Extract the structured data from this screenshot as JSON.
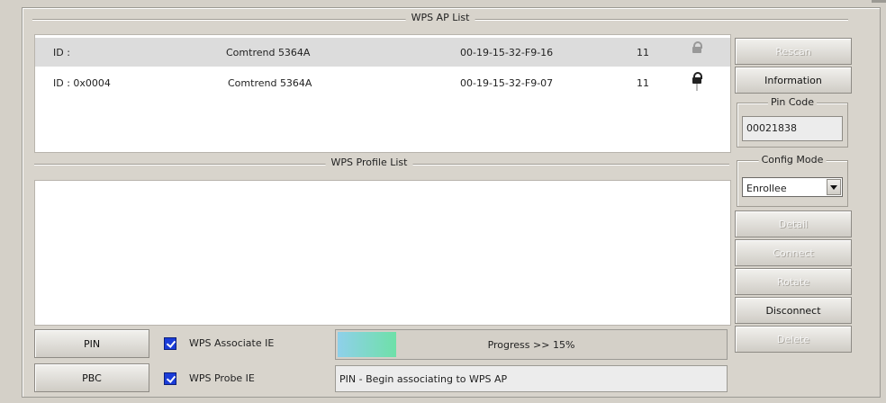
{
  "ap_list_title": "WPS AP List",
  "profile_list_title": "WPS Profile List",
  "ap_rows": [
    {
      "id": "ID :",
      "ssid": "Comtrend 5364A",
      "bssid": "00-19-15-32-F9-16",
      "channel": "11",
      "lock_icon": "lock-icon",
      "selected": true
    },
    {
      "id": "ID : 0x0004",
      "ssid": "Comtrend 5364A",
      "bssid": "00-19-15-32-F9-07",
      "channel": "11",
      "lock_icon": "lock-icon",
      "selected": false
    }
  ],
  "buttons": {
    "rescan": "Rescan",
    "information": "Information",
    "detail": "Detail",
    "connect": "Connect",
    "rotate": "Rotate",
    "disconnect": "Disconnect",
    "delete": "Delete",
    "pin": "PIN",
    "pbc": "PBC"
  },
  "pin_code": {
    "label": "Pin Code",
    "value": "00021838"
  },
  "config_mode": {
    "label": "Config Mode",
    "value": "Enrollee"
  },
  "checkboxes": {
    "associate": {
      "label": "WPS Associate IE",
      "checked": true
    },
    "probe": {
      "label": "WPS Probe IE",
      "checked": true
    }
  },
  "progress": {
    "text": "Progress >> 15%",
    "percent": 15
  },
  "status_text": "PIN - Begin associating to WPS AP",
  "colors": {
    "checkbox": "#1a3cd8",
    "progress_fill": "#6ee0a8"
  }
}
